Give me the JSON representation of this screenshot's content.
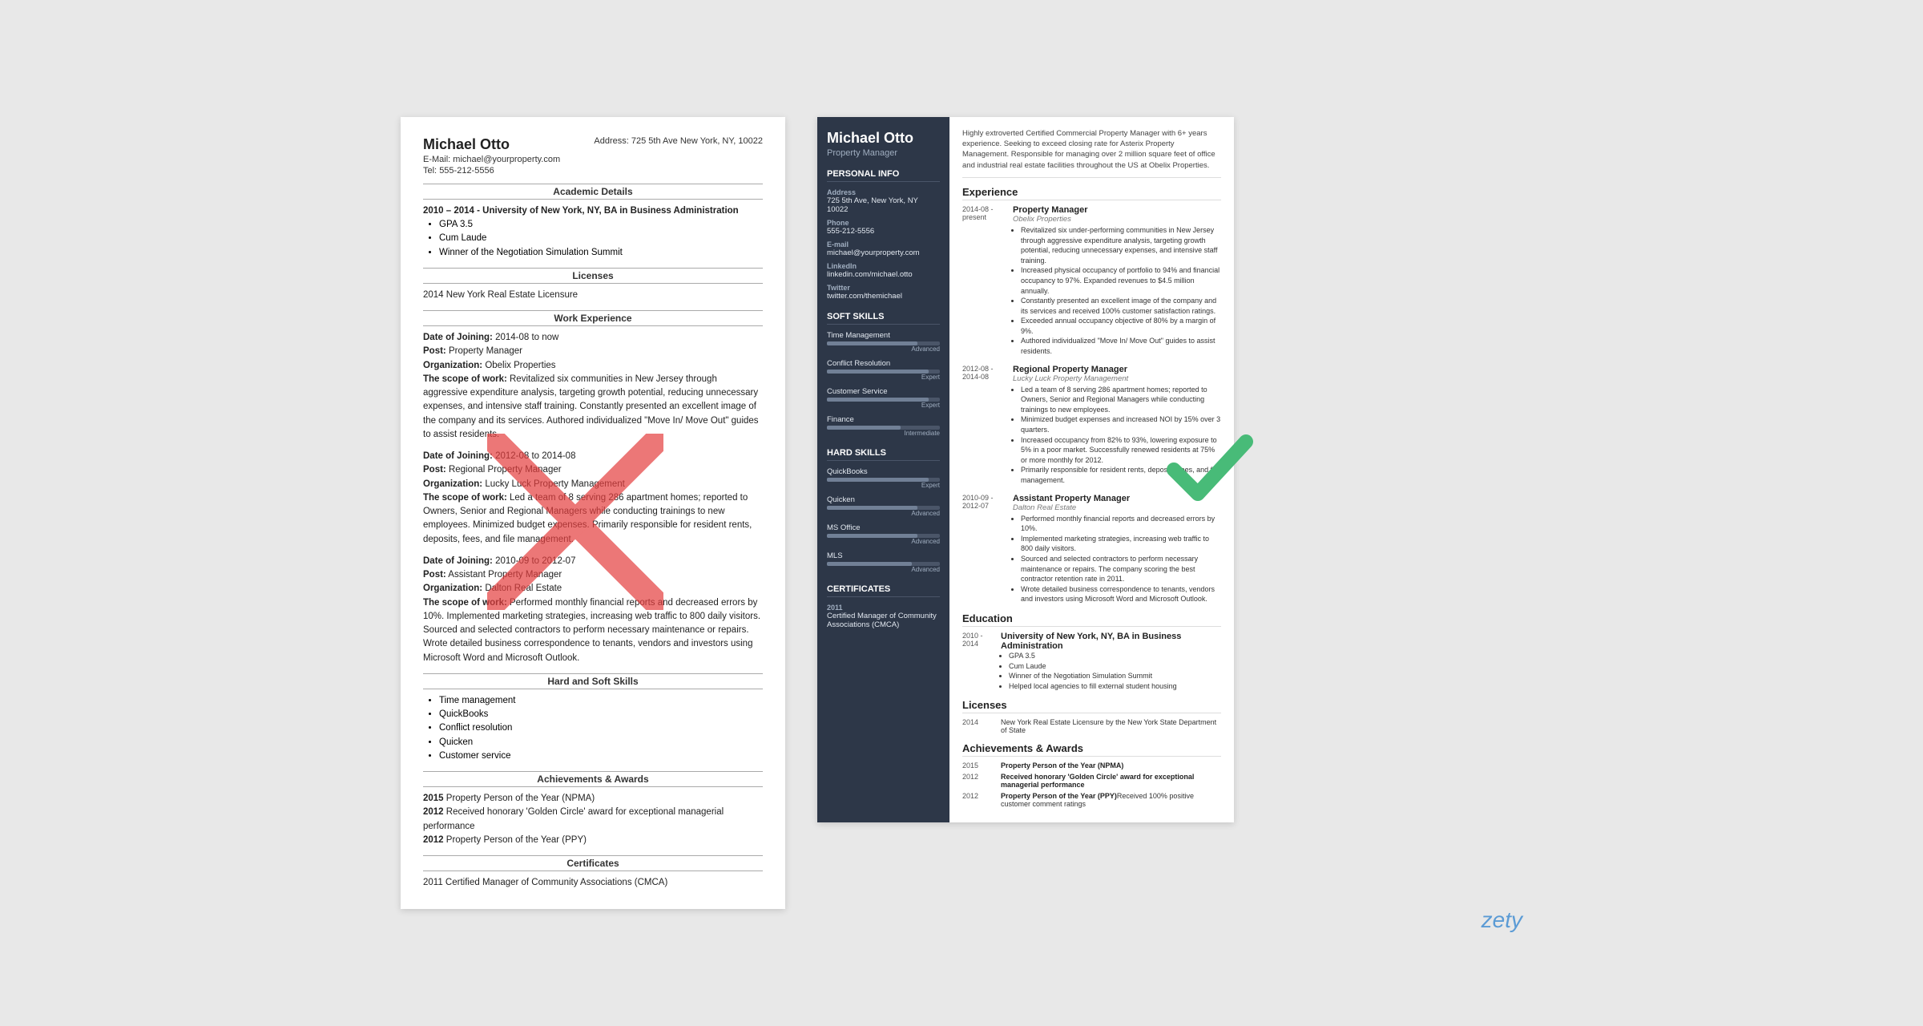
{
  "left_resume": {
    "name": "Michael Otto",
    "email_label": "E-Mail:",
    "email": "michael@yourproperty.com",
    "address_label": "Address:",
    "address": "725 5th Ave New York, NY, 10022",
    "tel_label": "Tel:",
    "tel": "555-212-5556",
    "academic_section": "Academic Details",
    "academic_entry": "2010 – 2014 - University of New York, NY, BA in Business Administration",
    "gpa": "GPA 3.5",
    "cum_laude": "Cum Laude",
    "winner": "Winner of the Negotiation Simulation Summit",
    "licenses_section": "Licenses",
    "license": "2014 New York Real Estate Licensure",
    "work_section": "Work Experience",
    "work_entries": [
      {
        "date_label": "Date of Joining:",
        "date": "2014-08 to now",
        "post_label": "Post:",
        "post": "Property Manager",
        "org_label": "Organization:",
        "org": "Obelix Properties",
        "scope_label": "The scope of work:",
        "scope": "Revitalized six communities in New Jersey through aggressive expenditure analysis, targeting growth potential, reducing unnecessary expenses, and intensive staff training. Constantly presented an excellent image of the company and its services. Authored individualized \"Move In/ Move Out\" guides to assist residents."
      },
      {
        "date_label": "Date of Joining:",
        "date": "2012-08 to 2014-08",
        "post_label": "Post:",
        "post": "Regional Property Manager",
        "org_label": "Organization:",
        "org": "Lucky Luck Property Management",
        "scope_label": "The scope of work:",
        "scope": "Led a team of 8 serving 286 apartment homes; reported to Owners, Senior and Regional Managers while conducting trainings to new employees. Minimized budget expenses. Primarily responsible for resident rents, deposits, fees, and file management."
      },
      {
        "date_label": "Date of Joining:",
        "date": "2010-09 to 2012-07",
        "post_label": "Post:",
        "post": "Assistant Property Manager",
        "org_label": "Organization:",
        "org": "Dalton Real Estate",
        "scope_label": "The scope of work:",
        "scope": "Performed monthly financial reports and decreased errors by 10%. Implemented marketing strategies, increasing web traffic to 800 daily visitors. Sourced and selected contractors to perform necessary maintenance or repairs. Wrote detailed business correspondence to tenants, vendors and investors using Microsoft Word and Microsoft Outlook."
      }
    ],
    "skills_section": "Hard and Soft Skills",
    "skills": [
      "Time management",
      "QuickBooks",
      "Conflict resolution",
      "Quicken",
      "Customer service"
    ],
    "achievements_section": "Achievements & Awards",
    "achievements": [
      "2015 Property Person of the Year (NPMA)",
      "2012 Received honorary 'Golden Circle' award for exceptional managerial performance",
      "2012 Property Person of the Year (PPY)"
    ],
    "certificates_section": "Certificates",
    "certificate": "2011 Certified Manager of Community Associations (CMCA)"
  },
  "right_resume": {
    "name": "Michael Otto",
    "title": "Property Manager",
    "summary": "Highly extroverted Certified Commercial Property Manager with 6+ years experience. Seeking to exceed closing rate for Asterix Property Management. Responsible for managing over 2 million square feet of office and industrial real estate facilities throughout the US at Obelix Properties.",
    "personal_info_section": "Personal Info",
    "address_label": "Address",
    "address": "725 5th Ave, New York, NY 10022",
    "phone_label": "Phone",
    "phone": "555-212-5556",
    "email_label": "E-mail",
    "email": "michael@yourproperty.com",
    "linkedin_label": "LinkedIn",
    "linkedin": "linkedin.com/michael.otto",
    "twitter_label": "Twitter",
    "twitter": "twitter.com/themichael",
    "soft_skills_section": "Soft Skills",
    "soft_skills": [
      {
        "name": "Time Management",
        "level": "Advanced",
        "pct": 80
      },
      {
        "name": "Conflict Resolution",
        "level": "Expert",
        "pct": 90
      },
      {
        "name": "Customer Service",
        "level": "Expert",
        "pct": 90
      },
      {
        "name": "Finance",
        "level": "Intermediate",
        "pct": 65
      }
    ],
    "hard_skills_section": "Hard Skills",
    "hard_skills": [
      {
        "name": "QuickBooks",
        "level": "Expert",
        "pct": 90
      },
      {
        "name": "Quicken",
        "level": "Advanced",
        "pct": 80
      },
      {
        "name": "MS Office",
        "level": "Advanced",
        "pct": 80
      },
      {
        "name": "MLS",
        "level": "Advanced",
        "pct": 75
      }
    ],
    "certificates_section": "Certificates",
    "certificate_year": "2011",
    "certificate": "Certified Manager of Community Associations (CMCA)",
    "experience_section": "Experience",
    "experience": [
      {
        "date_start": "2014-08 -",
        "date_end": "present",
        "job": "Property Manager",
        "company": "Obelix Properties",
        "bullets": [
          "Revitalized six under-performing communities in New Jersey through aggressive expenditure analysis, targeting growth potential, reducing unnecessary expenses, and intensive staff training.",
          "Increased physical occupancy of portfolio to 94% and financial occupancy to 97%. Expanded revenues to $4.5 million annually.",
          "Constantly presented an excellent image of the company and its services and received 100% customer satisfaction ratings.",
          "Exceeded annual occupancy objective of 80% by a margin of 9%.",
          "Authored individualized \"Move In/ Move Out\" guides to assist residents."
        ]
      },
      {
        "date_start": "2012-08 -",
        "date_end": "2014-08",
        "job": "Regional Property Manager",
        "company": "Lucky Luck Property Management",
        "bullets": [
          "Led a team of 8 serving 286 apartment homes; reported to Owners, Senior and Regional Managers while conducting trainings to new employees.",
          "Minimized budget expenses and increased NOI by 15% over 3 quarters.",
          "Increased occupancy from 82% to 93%, lowering exposure to 5% in a poor market. Successfully renewed residents at 75% or more monthly for 2012.",
          "Primarily responsible for resident rents, deposits, fees, and file management."
        ]
      },
      {
        "date_start": "2010-09 -",
        "date_end": "2012-07",
        "job": "Assistant Property Manager",
        "company": "Dalton Real Estate",
        "bullets": [
          "Performed monthly financial reports and decreased errors by 10%.",
          "Implemented marketing strategies, increasing web traffic to 800 daily visitors.",
          "Sourced and selected contractors to perform necessary maintenance or repairs. The company scoring the best contractor retention rate in 2011.",
          "Wrote detailed business correspondence to tenants, vendors and investors using Microsoft Word and Microsoft Outlook."
        ]
      }
    ],
    "education_section": "Education",
    "education": [
      {
        "date_start": "2010 -",
        "date_end": "2014",
        "title": "University of New York, NY, BA in Business Administration",
        "bullets": [
          "GPA 3.5",
          "Cum Laude",
          "Winner of the Negotiation Simulation Summit",
          "Helped local agencies to fill external student housing"
        ]
      }
    ],
    "licenses_section": "Licenses",
    "licenses": [
      {
        "year": "2014",
        "text": "New York Real Estate Licensure by the New York State Department of State"
      }
    ],
    "achievements_section": "Achievements & Awards",
    "achievements": [
      {
        "year": "2015",
        "text_bold": "Property Person of the Year (NPMA)",
        "text_rest": ""
      },
      {
        "year": "2012",
        "text_bold": "Received honorary 'Golden Circle' award for exceptional managerial performance",
        "text_rest": ""
      },
      {
        "year": "2012",
        "text_bold": "Property Person of the Year (PPY)",
        "text_rest": "Received 100% positive customer comment ratings"
      }
    ]
  },
  "watermark": "zety"
}
